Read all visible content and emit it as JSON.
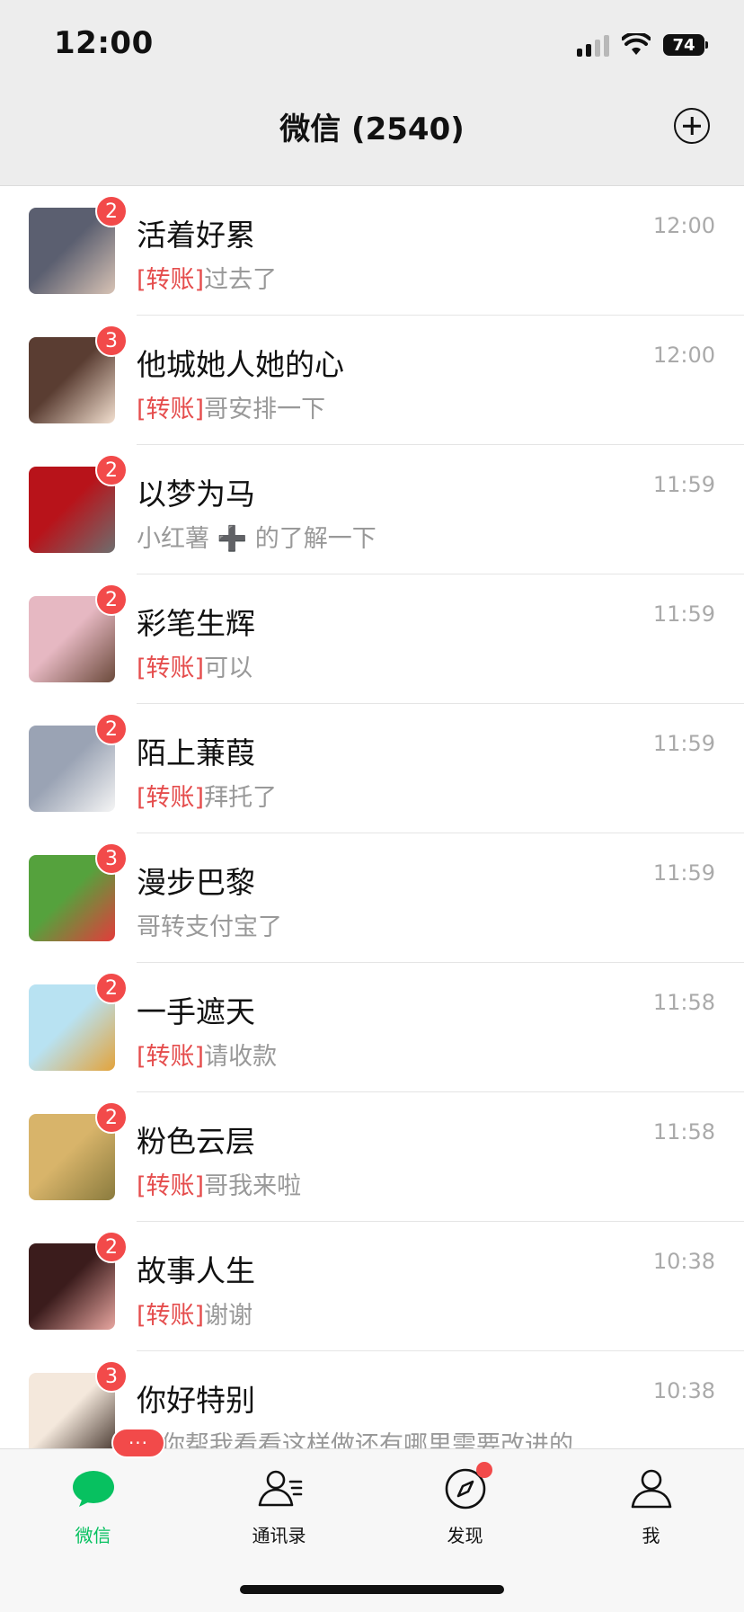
{
  "status_bar": {
    "time": "12:00",
    "battery": "74"
  },
  "header": {
    "title": "微信 (2540)",
    "add_icon": "plus-circle-icon"
  },
  "chats": [
    {
      "name": "活着好累",
      "time": "12:00",
      "badge": "2",
      "tag": "[转账]",
      "message": "过去了",
      "avatar_colors": [
        "#5b5f70",
        "#d8c3b5"
      ]
    },
    {
      "name": "他城她人她的心",
      "time": "12:00",
      "badge": "3",
      "tag": "[转账]",
      "message": "哥安排一下",
      "avatar_colors": [
        "#5a3d32",
        "#f3e0d0"
      ]
    },
    {
      "name": "以梦为马",
      "time": "11:59",
      "badge": "2",
      "tag": "",
      "message": "小红薯 ➕ 的了解一下",
      "avatar_colors": [
        "#b8131a",
        "#6e6e6e"
      ]
    },
    {
      "name": "彩笔生辉",
      "time": "11:59",
      "badge": "2",
      "tag": "[转账]",
      "message": "可以",
      "avatar_colors": [
        "#e6b8c2",
        "#6b4a3b"
      ]
    },
    {
      "name": "陌上蒹葭",
      "time": "11:59",
      "badge": "2",
      "tag": "[转账]",
      "message": "拜托了",
      "avatar_colors": [
        "#9aa3b4",
        "#f5f5f5"
      ]
    },
    {
      "name": "漫步巴黎",
      "time": "11:59",
      "badge": "3",
      "tag": "",
      "message": "哥转支付宝了",
      "avatar_colors": [
        "#55a23d",
        "#e43b3b"
      ]
    },
    {
      "name": "一手遮天",
      "time": "11:58",
      "badge": "2",
      "tag": "[转账]",
      "message": "请收款",
      "avatar_colors": [
        "#b8e2f2",
        "#e3a33b"
      ]
    },
    {
      "name": "粉色云层",
      "time": "11:58",
      "badge": "2",
      "tag": "[转账]",
      "message": "哥我来啦",
      "avatar_colors": [
        "#d8b46a",
        "#8a7b3e"
      ]
    },
    {
      "name": "故事人生",
      "time": "10:38",
      "badge": "2",
      "tag": "[转账]",
      "message": "谢谢",
      "avatar_colors": [
        "#3b1c1c",
        "#e8a6a0"
      ]
    },
    {
      "name": "你好特别",
      "time": "10:38",
      "badge": "3",
      "tag": "",
      "message": "哥你帮我看看这样做还有哪里需要改进的",
      "avatar_colors": [
        "#f4e8dc",
        "#3a2a22"
      ]
    }
  ],
  "tabbar": {
    "tabs": [
      {
        "label": "微信",
        "icon": "chat-bubble-icon",
        "active": true
      },
      {
        "label": "通讯录",
        "icon": "contacts-icon",
        "active": false
      },
      {
        "label": "发现",
        "icon": "compass-icon",
        "active": false
      },
      {
        "label": "我",
        "icon": "person-icon",
        "active": false
      }
    ],
    "more_badge": "···"
  },
  "colors": {
    "accent": "#07c160",
    "badge": "#f24a4a",
    "tag": "#e54d4d"
  }
}
